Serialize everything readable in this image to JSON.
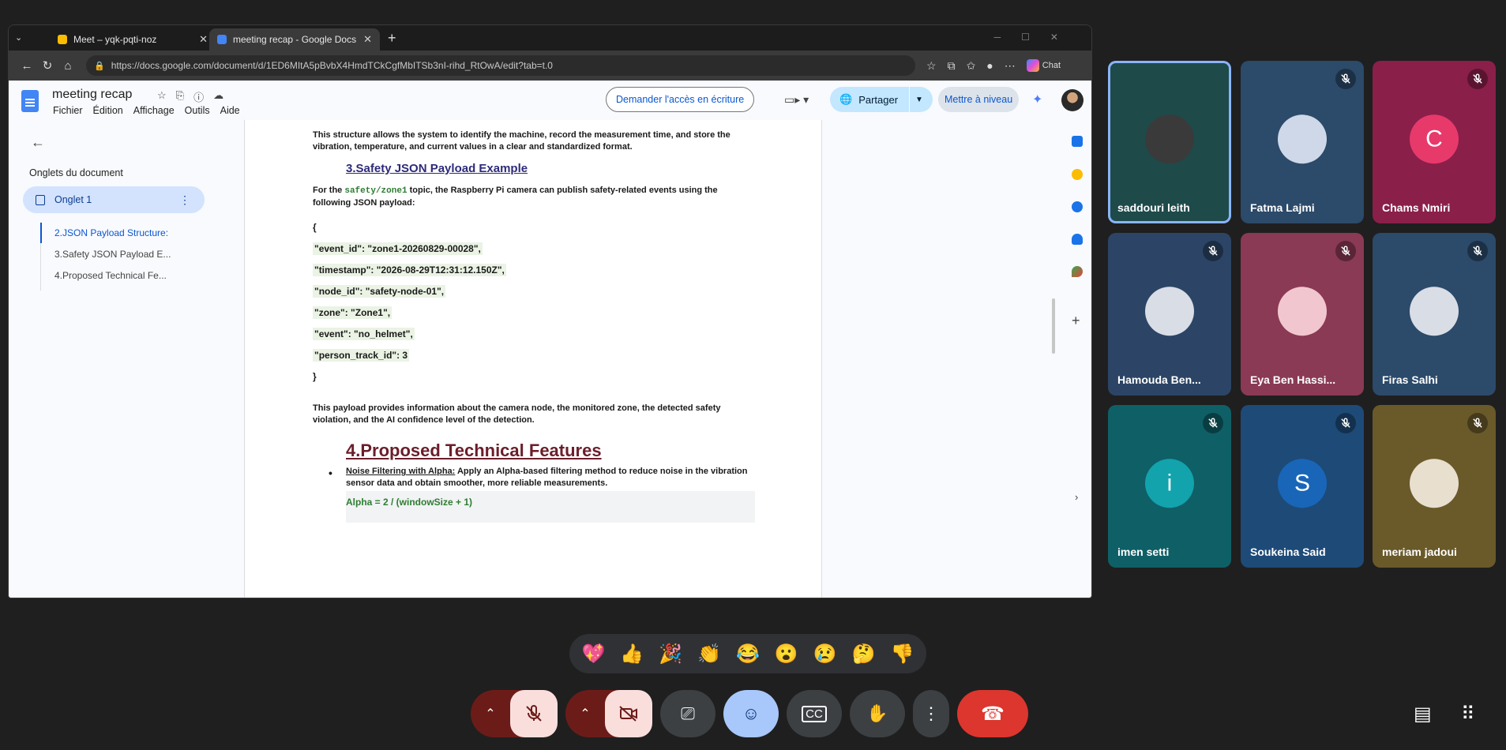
{
  "browser": {
    "tabs": [
      {
        "label": "Meet – yqk-pqti-noz",
        "active": false
      },
      {
        "label": "meeting recap - Google Docs",
        "active": true
      }
    ],
    "url": "https://docs.google.com/document/d/1ED6MItA5pBvbX4HmdTCkCgfMbITSb3nI-rihd_RtOwA/edit?tab=t.0",
    "chat_label": "Chat"
  },
  "docs": {
    "title": "meeting recap",
    "menu": [
      "Fichier",
      "Édition",
      "Affichage",
      "Outils",
      "Aide"
    ],
    "access_button": "Demander l'accès en écriture",
    "share_button": "Partager",
    "upgrade_button": "Mettre à niveau",
    "sidebar": {
      "heading": "Onglets du document",
      "tab_label": "Onglet 1",
      "outline": [
        "2.JSON Payload Structure:",
        "3.Safety JSON Payload E...",
        "4.Proposed Technical Fe..."
      ]
    },
    "body": {
      "para_top": "This structure allows the system to identify the machine, record the measurement time, and store the vibration, temperature, and current values in a clear and standardized format.",
      "heading3": "3.Safety JSON Payload Example",
      "para_mid_prefix": "For the ",
      "para_mid_code": "safety/zone1",
      "para_mid_suffix": " topic, the Raspberry Pi camera can publish safety-related events using the following JSON payload:",
      "json_lines": [
        "{",
        "\"event_id\": \"zone1-20260829-00028\",",
        "\"timestamp\": \"2026-08-29T12:31:12.150Z\",",
        "\"node_id\": \"safety-node-01\",",
        "\"zone\": \"Zone1\",",
        "\"event\": \"no_helmet\",",
        "\"person_track_id\": 3",
        "}"
      ],
      "para_bottom": "This payload provides information about the camera node, the monitored zone, the detected safety violation, and the AI confidence level of the detection.",
      "heading4": "4.Proposed Technical Features",
      "bullet_title": "Noise Filtering with Alpha:",
      "bullet_text": " Apply an Alpha-based filtering method to reduce noise in the vibration sensor data and obtain smoother, more reliable measurements.",
      "code": "Alpha = 2 / (windowSize + 1)"
    }
  },
  "participants": [
    {
      "name": "saddouri leith",
      "bg": "#1e4a4a",
      "avatar_bg": "#3a3a3a",
      "initial": "",
      "muted": false,
      "speaking": true
    },
    {
      "name": "Fatma Lajmi",
      "bg": "#2c4a6a",
      "avatar_bg": "#cfd8e8",
      "initial": "",
      "muted": true
    },
    {
      "name": "Chams Nmiri",
      "bg": "#8a1f4a",
      "avatar_bg": "#e8396b",
      "initial": "C",
      "muted": true
    },
    {
      "name": "Hamouda Ben...",
      "bg": "#2c4566",
      "avatar_bg": "#d9dde6",
      "initial": "",
      "muted": true
    },
    {
      "name": "Eya Ben Hassi...",
      "bg": "#8a3a55",
      "avatar_bg": "#f2c6cf",
      "initial": "",
      "muted": true
    },
    {
      "name": "Firas Salhi",
      "bg": "#2c4a6a",
      "avatar_bg": "#d9dde6",
      "initial": "",
      "muted": true
    },
    {
      "name": "imen setti",
      "bg": "#0f5f66",
      "avatar_bg": "#12a3ad",
      "initial": "i",
      "muted": true
    },
    {
      "name": "Soukeina Said",
      "bg": "#1e4a78",
      "avatar_bg": "#1966b8",
      "initial": "S",
      "muted": true
    },
    {
      "name": "meriam jadoui",
      "bg": "#6a5a2a",
      "avatar_bg": "#e8dfcf",
      "initial": "",
      "muted": true
    }
  ],
  "reactions": [
    "💖",
    "👍",
    "🎉",
    "👏",
    "😂",
    "😮",
    "😢",
    "🤔",
    "👎"
  ],
  "icons": {
    "mic_off": "mic-off-icon",
    "cam_off": "camera-off-icon",
    "present": "present-icon",
    "emoji": "emoji-icon",
    "captions": "captions-icon",
    "hand": "raise-hand-icon",
    "more": "more-icon",
    "end_call": "end-call-icon"
  }
}
